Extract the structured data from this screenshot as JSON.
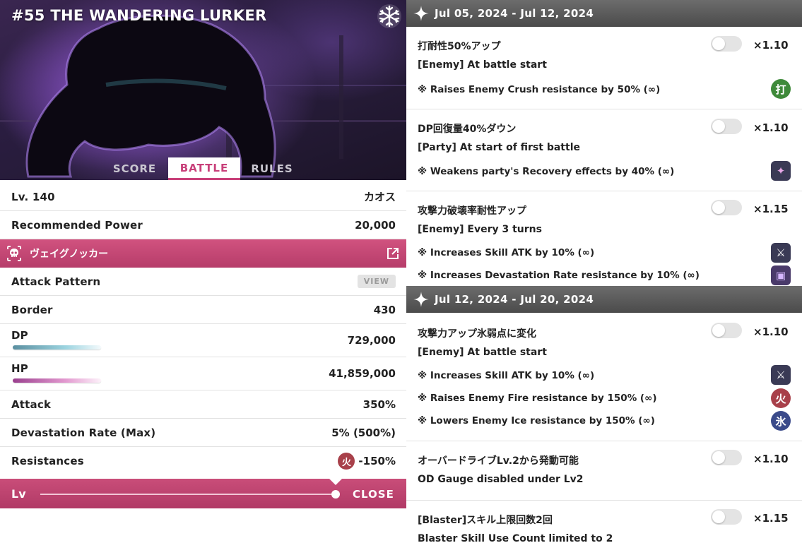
{
  "quest": {
    "title": "#55 THE WANDERING LURKER",
    "element_badge": "snowflake-icon",
    "tabs": [
      "SCORE",
      "BATTLE",
      "RULES"
    ],
    "active_tab": "BATTLE"
  },
  "stats": {
    "level_label": "Lv. 140",
    "difficulty": "カオス",
    "recommended_power_label": "Recommended Power",
    "recommended_power": "20,000"
  },
  "enemy": {
    "name": "ヴェイグノッカー",
    "icon": "skull-icon",
    "link_icon": "external-link-icon",
    "attack_pattern_label": "Attack Pattern",
    "view_label": "VIEW",
    "border_label": "Border",
    "border": "430",
    "dp_label": "DP",
    "dp": "729,000",
    "hp_label": "HP",
    "hp": "41,859,000",
    "attack_label": "Attack",
    "attack": "350%",
    "devastation_label": "Devastation Rate (Max)",
    "devastation": "5% (500%)",
    "resistances_label": "Resistances",
    "resistance_icon_glyph": "火",
    "resistance_value": "-150%"
  },
  "footer": {
    "lv_label": "Lv",
    "slider_level": 1.0,
    "close_label": "CLOSE"
  },
  "periods": [
    {
      "date": "Jul 05, 2024 - Jul 12, 2024",
      "conditions": [
        {
          "title": "打耐性50%アップ",
          "multiplier": "×1.10",
          "target": "[Enemy] At battle start",
          "effects": [
            {
              "text": "※ Raises Enemy Crush resistance by 50% (∞)",
              "icon_glyph": "打",
              "icon_color": "#3f8a3a"
            }
          ]
        },
        {
          "title": "DP回復量40%ダウン",
          "multiplier": "×1.10",
          "target": "[Party] At start of first battle",
          "effects": [
            {
              "text": "※ Weakens party's Recovery effects by 40% (∞)",
              "icon_glyph": "✦",
              "icon_color": "#3a3a55"
            }
          ]
        },
        {
          "title": "攻撃力破壊率耐性アップ",
          "multiplier": "×1.15",
          "target": "[Enemy] Every 3 turns",
          "effects": [
            {
              "text": "※ Increases Skill ATK by 10% (∞)",
              "icon_glyph": "⚔",
              "icon_color": "#3a3a55"
            },
            {
              "text": "※ Increases Devastation Rate resistance by 10% (∞)",
              "icon_glyph": "▣",
              "icon_color": "#4a3a6a"
            }
          ]
        }
      ]
    },
    {
      "date": "Jul 12, 2024 - Jul 20, 2024",
      "conditions": [
        {
          "title": "攻撃力アップ氷弱点に変化",
          "multiplier": "×1.10",
          "target": "[Enemy] At battle start",
          "effects": [
            {
              "text": "※ Increases Skill ATK by 10% (∞)",
              "icon_glyph": "⚔",
              "icon_color": "#3a3a55"
            },
            {
              "text": "※ Raises Enemy Fire resistance by 150% (∞)",
              "icon_glyph": "火",
              "icon_color": "#a8404a"
            },
            {
              "text": "※ Lowers Enemy Ice resistance by 150% (∞)",
              "icon_glyph": "氷",
              "icon_color": "#3a4a8a"
            }
          ]
        },
        {
          "title": "オーバードライブLv.2から発動可能",
          "multiplier": "×1.10",
          "target": "OD Gauge disabled under Lv2",
          "effects": []
        },
        {
          "title": "[Blaster]スキル上限回数2回",
          "multiplier": "×1.15",
          "target": "Blaster Skill Use Count limited to 2",
          "effects": []
        }
      ]
    }
  ]
}
